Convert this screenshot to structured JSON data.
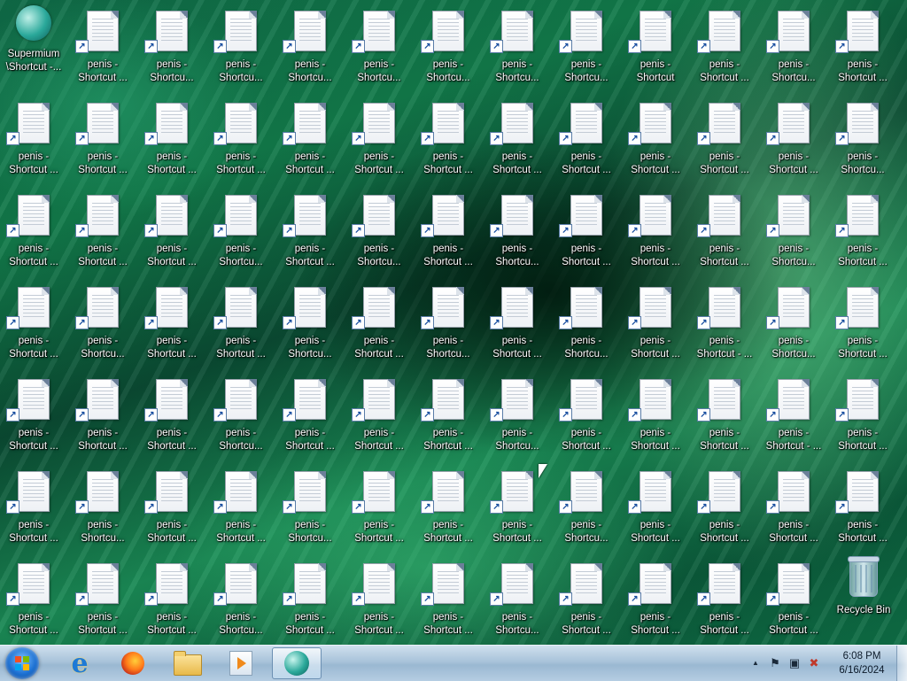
{
  "desktop": {
    "special": {
      "app_shortcut": {
        "line1": "Supermium",
        "line2": "\\Shortcut -..."
      },
      "recycle_bin": {
        "label": "Recycle Bin"
      }
    },
    "grid": [
      [
        null,
        [
          "penis -",
          "Shortcut ..."
        ],
        [
          "penis -",
          "Shortcu..."
        ],
        [
          "penis -",
          "Shortcu..."
        ],
        [
          "penis -",
          "Shortcu..."
        ],
        [
          "penis -",
          "Shortcu..."
        ],
        [
          "penis -",
          "Shortcu..."
        ],
        [
          "penis -",
          "Shortcu..."
        ],
        [
          "penis -",
          "Shortcu..."
        ],
        [
          "penis -",
          "Shortcut"
        ],
        [
          "penis -",
          "Shortcut ..."
        ],
        [
          "penis -",
          "Shortcu..."
        ],
        [
          "penis -",
          "Shortcut ..."
        ]
      ],
      [
        [
          "penis -",
          "Shortcut ..."
        ],
        [
          "penis -",
          "Shortcut ..."
        ],
        [
          "penis -",
          "Shortcut ..."
        ],
        [
          "penis -",
          "Shortcut ..."
        ],
        [
          "penis -",
          "Shortcut ..."
        ],
        [
          "penis -",
          "Shortcut ..."
        ],
        [
          "penis -",
          "Shortcut ..."
        ],
        [
          "penis -",
          "Shortcut ..."
        ],
        [
          "penis -",
          "Shortcut ..."
        ],
        [
          "penis -",
          "Shortcut ..."
        ],
        [
          "penis -",
          "Shortcut ..."
        ],
        [
          "penis -",
          "Shortcut ..."
        ],
        [
          "penis -",
          "Shortcu..."
        ]
      ],
      [
        [
          "penis -",
          "Shortcut ..."
        ],
        [
          "penis -",
          "Shortcut ..."
        ],
        [
          "penis -",
          "Shortcut ..."
        ],
        [
          "penis -",
          "Shortcu..."
        ],
        [
          "penis -",
          "Shortcut ..."
        ],
        [
          "penis -",
          "Shortcu..."
        ],
        [
          "penis -",
          "Shortcut ..."
        ],
        [
          "penis -",
          "Shortcu..."
        ],
        [
          "penis -",
          "Shortcut ..."
        ],
        [
          "penis -",
          "Shortcut ..."
        ],
        [
          "penis -",
          "Shortcut ..."
        ],
        [
          "penis -",
          "Shortcu..."
        ],
        [
          "penis -",
          "Shortcut ..."
        ]
      ],
      [
        [
          "penis -",
          "Shortcut ..."
        ],
        [
          "penis -",
          "Shortcu..."
        ],
        [
          "penis -",
          "Shortcut ..."
        ],
        [
          "penis -",
          "Shortcut ..."
        ],
        [
          "penis -",
          "Shortcu..."
        ],
        [
          "penis -",
          "Shortcut ..."
        ],
        [
          "penis -",
          "Shortcu..."
        ],
        [
          "penis -",
          "Shortcut ..."
        ],
        [
          "penis -",
          "Shortcu..."
        ],
        [
          "penis -",
          "Shortcut ..."
        ],
        [
          "penis -",
          "Shortcut - ..."
        ],
        [
          "penis -",
          "Shortcu..."
        ],
        [
          "penis -",
          "Shortcut ..."
        ]
      ],
      [
        [
          "penis -",
          "Shortcut ..."
        ],
        [
          "penis -",
          "Shortcut ..."
        ],
        [
          "penis -",
          "Shortcut ..."
        ],
        [
          "penis -",
          "Shortcu..."
        ],
        [
          "penis -",
          "Shortcut ..."
        ],
        [
          "penis -",
          "Shortcut ..."
        ],
        [
          "penis -",
          "Shortcut ..."
        ],
        [
          "penis -",
          "Shortcu..."
        ],
        [
          "penis -",
          "Shortcut ..."
        ],
        [
          "penis -",
          "Shortcut ..."
        ],
        [
          "penis -",
          "Shortcut ..."
        ],
        [
          "penis -",
          "Shortcut - ..."
        ],
        [
          "penis -",
          "Shortcut ..."
        ]
      ],
      [
        [
          "penis -",
          "Shortcut ..."
        ],
        [
          "penis -",
          "Shortcu..."
        ],
        [
          "penis -",
          "Shortcut ..."
        ],
        [
          "penis -",
          "Shortcut ..."
        ],
        [
          "penis -",
          "Shortcu..."
        ],
        [
          "penis -",
          "Shortcut ..."
        ],
        [
          "penis -",
          "Shortcut ..."
        ],
        [
          "penis -",
          "Shortcut ..."
        ],
        [
          "penis -",
          "Shortcu..."
        ],
        [
          "penis -",
          "Shortcut ..."
        ],
        [
          "penis -",
          "Shortcut ..."
        ],
        [
          "penis -",
          "Shortcut ..."
        ],
        [
          "penis -",
          "Shortcut ..."
        ]
      ],
      [
        [
          "penis -",
          "Shortcut ..."
        ],
        [
          "penis -",
          "Shortcut ..."
        ],
        [
          "penis -",
          "Shortcut ..."
        ],
        [
          "penis -",
          "Shortcu..."
        ],
        [
          "penis -",
          "Shortcut ..."
        ],
        [
          "penis -",
          "Shortcut ..."
        ],
        [
          "penis -",
          "Shortcut ..."
        ],
        [
          "penis -",
          "Shortcu..."
        ],
        [
          "penis -",
          "Shortcut ..."
        ],
        [
          "penis -",
          "Shortcut ..."
        ],
        [
          "penis -",
          "Shortcut ..."
        ],
        [
          "penis -",
          "Shortcut ..."
        ],
        null
      ]
    ]
  },
  "taskbar": {
    "pinned": [
      {
        "name": "internet-explorer-icon",
        "glyph": "e"
      },
      {
        "name": "firefox-icon"
      },
      {
        "name": "file-explorer-icon"
      },
      {
        "name": "media-player-icon"
      },
      {
        "name": "supermium-icon",
        "active": true
      }
    ],
    "tray": {
      "show_hidden": "▲",
      "flag": "⚑",
      "network": "▣",
      "volume": "✖"
    },
    "clock": {
      "time": "6:08 PM",
      "date": "6/16/2024"
    }
  }
}
